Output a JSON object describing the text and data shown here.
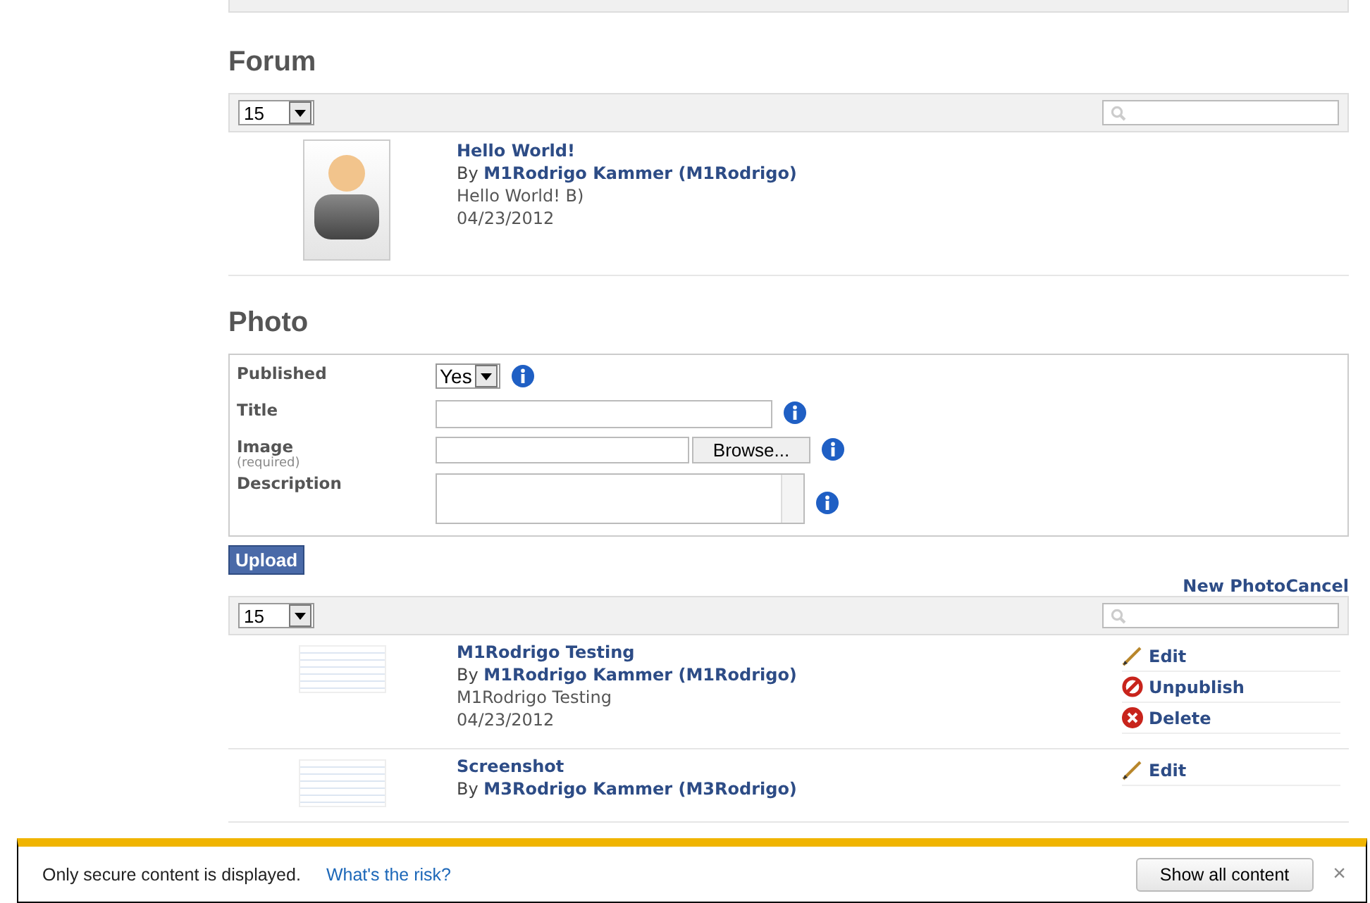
{
  "forum": {
    "title": "Forum",
    "page_size": "15",
    "posts": [
      {
        "kind": "avatar",
        "title": "Hello World!",
        "by": "By",
        "author": "M1Rodrigo Kammer (M1Rodrigo)",
        "body": "Hello World! B)",
        "date": "04/23/2012"
      }
    ]
  },
  "photo": {
    "title": "Photo",
    "fields": [
      {
        "kind": "select",
        "label": "Published",
        "value": "Yes"
      },
      {
        "kind": "text",
        "label": "Title"
      },
      {
        "kind": "file",
        "label": "Image",
        "hint": "(required)",
        "button": "Browse..."
      },
      {
        "kind": "textarea",
        "label": "Description"
      }
    ],
    "upload": "Upload",
    "links": [
      "New Photo",
      "Cancel"
    ],
    "page_size": "15",
    "items": [
      {
        "kind": "screenshot",
        "title": "M1Rodrigo Testing",
        "by": "By",
        "author": "M1Rodrigo Kammer (M1Rodrigo)",
        "body": "M1Rodrigo Testing",
        "date": "04/23/2012",
        "actions": [
          {
            "kind": "edit",
            "label": "Edit"
          },
          {
            "kind": "unpublish",
            "label": "Unpublish"
          },
          {
            "kind": "delete",
            "label": "Delete"
          }
        ]
      },
      {
        "kind": "screenshot",
        "title": "Screenshot",
        "by": "By",
        "author": "M3Rodrigo Kammer (M3Rodrigo)",
        "actions": [
          {
            "kind": "edit",
            "label": "Edit"
          }
        ]
      }
    ]
  },
  "notification": {
    "message": "Only secure content is displayed.",
    "link": "What's the risk?",
    "button": "Show all content",
    "close": "×"
  }
}
